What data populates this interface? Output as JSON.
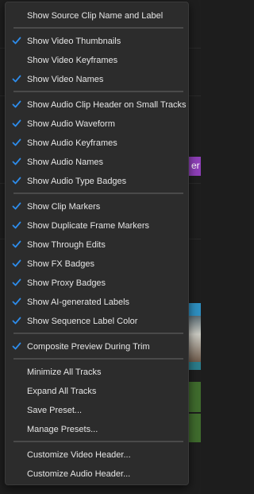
{
  "menu": {
    "items": [
      {
        "label": "Show Source Clip Name and Label",
        "checked": false
      },
      {
        "label": "Show Video Thumbnails",
        "checked": true
      },
      {
        "label": "Show Video Keyframes",
        "checked": false
      },
      {
        "label": "Show Video Names",
        "checked": true
      },
      {
        "label": "Show Audio Clip Header on Small Tracks",
        "checked": true
      },
      {
        "label": "Show Audio Waveform",
        "checked": true
      },
      {
        "label": "Show Audio Keyframes",
        "checked": true
      },
      {
        "label": "Show Audio Names",
        "checked": true
      },
      {
        "label": "Show Audio Type Badges",
        "checked": true
      },
      {
        "label": "Show Clip Markers",
        "checked": true
      },
      {
        "label": "Show Duplicate Frame Markers",
        "checked": true
      },
      {
        "label": "Show Through Edits",
        "checked": true
      },
      {
        "label": "Show FX Badges",
        "checked": true
      },
      {
        "label": "Show Proxy Badges",
        "checked": true
      },
      {
        "label": "Show AI-generated Labels",
        "checked": true
      },
      {
        "label": "Show Sequence Label Color",
        "checked": true
      },
      {
        "label": "Composite Preview During Trim",
        "checked": true
      },
      {
        "label": "Minimize All Tracks",
        "checked": false
      },
      {
        "label": "Expand All Tracks",
        "checked": false
      },
      {
        "label": "Save Preset...",
        "checked": false
      },
      {
        "label": "Manage Presets...",
        "checked": false
      },
      {
        "label": "Customize Video Header...",
        "checked": false
      },
      {
        "label": "Customize Audio Header...",
        "checked": false
      }
    ]
  },
  "background": {
    "clip_label_fragment": "er"
  },
  "colors": {
    "menu_bg": "#2c2c2c",
    "check_blue": "#2d8ceb",
    "text": "#e6e6e6",
    "separator": "#4a4a4a"
  }
}
